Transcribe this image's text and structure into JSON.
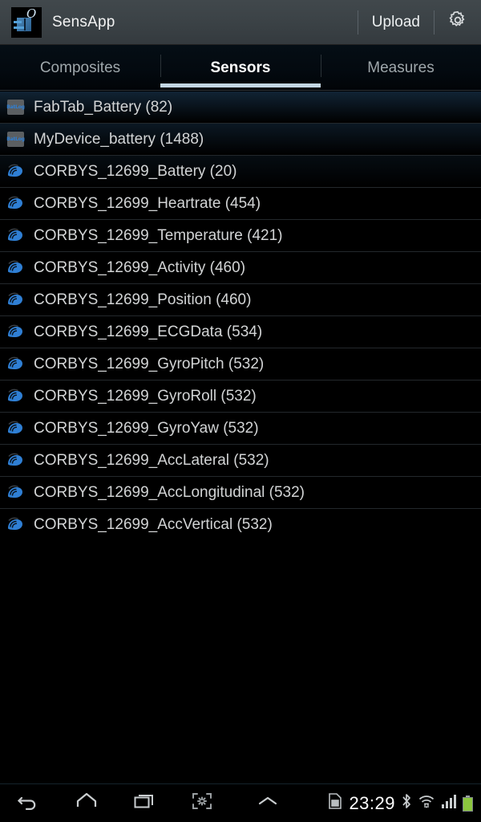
{
  "app": {
    "title": "SensApp",
    "icon_name": "sensapp-logo-icon",
    "upload_label": "Upload",
    "settings_icon": "gear-icon"
  },
  "tabs": [
    {
      "label": "Composites",
      "active": false
    },
    {
      "label": "Sensors",
      "active": true
    },
    {
      "label": "Measures",
      "active": false
    }
  ],
  "sensors": [
    {
      "label": "FabTab_Battery (82)",
      "icon": "batlog-icon",
      "icon_text": "BatLog"
    },
    {
      "label": "MyDevice_battery (1488)",
      "icon": "batlog-icon",
      "icon_text": "BatLog"
    },
    {
      "label": "CORBYS_12699_Battery (20)",
      "icon": "sensor-wave-icon"
    },
    {
      "label": "CORBYS_12699_Heartrate (454)",
      "icon": "sensor-wave-icon"
    },
    {
      "label": "CORBYS_12699_Temperature (421)",
      "icon": "sensor-wave-icon"
    },
    {
      "label": "CORBYS_12699_Activity (460)",
      "icon": "sensor-wave-icon"
    },
    {
      "label": "CORBYS_12699_Position (460)",
      "icon": "sensor-wave-icon"
    },
    {
      "label": "CORBYS_12699_ECGData (534)",
      "icon": "sensor-wave-icon"
    },
    {
      "label": "CORBYS_12699_GyroPitch (532)",
      "icon": "sensor-wave-icon"
    },
    {
      "label": "CORBYS_12699_GyroRoll (532)",
      "icon": "sensor-wave-icon"
    },
    {
      "label": "CORBYS_12699_GyroYaw (532)",
      "icon": "sensor-wave-icon"
    },
    {
      "label": "CORBYS_12699_AccLateral (532)",
      "icon": "sensor-wave-icon"
    },
    {
      "label": "CORBYS_12699_AccLongitudinal (532)",
      "icon": "sensor-wave-icon"
    },
    {
      "label": "CORBYS_12699_AccVertical (532)",
      "icon": "sensor-wave-icon"
    }
  ],
  "navbar": {
    "back_icon": "back-arrow-icon",
    "home_icon": "home-icon",
    "recents_icon": "recent-apps-icon",
    "screenshot_icon": "screenshot-capture-icon",
    "expand_icon": "chevron-up-icon",
    "sim_icon": "sim-card-icon",
    "clock": "23:29",
    "bluetooth_icon": "bluetooth-icon",
    "wifi_icon": "wifi-icon",
    "signal_icon": "cellular-signal-icon",
    "battery_icon": "battery-full-icon"
  },
  "colors": {
    "accent": "#2f7fd4",
    "tab_active_underline": "#c3d6e3",
    "appbar_bg": "#3b4246",
    "battery_green": "#8cc63e"
  }
}
